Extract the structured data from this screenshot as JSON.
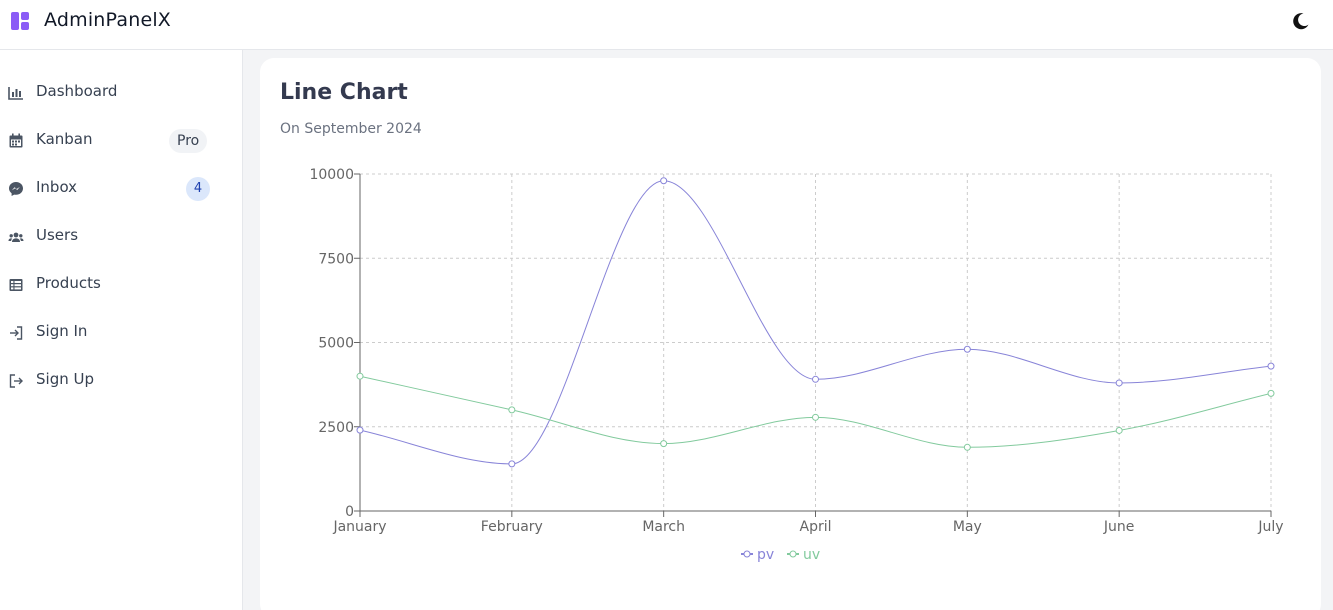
{
  "header": {
    "app_name": "AdminPanelX",
    "logo_icon": "dashboard-layout-icon",
    "theme_toggle_icon": "moon-icon",
    "brand_color": "#8b5cf6"
  },
  "sidebar": {
    "items": [
      {
        "label": "Dashboard",
        "icon": "bar-chart-icon"
      },
      {
        "label": "Kanban",
        "icon": "calendar-icon",
        "badge": "Pro"
      },
      {
        "label": "Inbox",
        "icon": "messenger-icon",
        "badge": "4"
      },
      {
        "label": "Users",
        "icon": "users-icon"
      },
      {
        "label": "Products",
        "icon": "table-list-icon"
      },
      {
        "label": "Sign In",
        "icon": "sign-in-icon"
      },
      {
        "label": "Sign Up",
        "icon": "sign-out-icon"
      }
    ]
  },
  "main": {
    "card_title": "Line Chart",
    "card_subtitle": "On September 2024"
  },
  "chart_data": {
    "type": "line",
    "title": "",
    "xlabel": "",
    "ylabel": "",
    "x": [
      "January",
      "February",
      "March",
      "April",
      "May",
      "June",
      "July"
    ],
    "series": [
      {
        "name": "pv",
        "values": [
          2400,
          1398,
          9800,
          3908,
          4800,
          3800,
          4300
        ],
        "color": "#8884d8"
      },
      {
        "name": "uv",
        "values": [
          4000,
          3000,
          2000,
          2780,
          1890,
          2390,
          3490
        ],
        "color": "#82ca9d"
      }
    ],
    "ylim": [
      0,
      10000
    ],
    "yticks": [
      "0",
      "2500",
      "5000",
      "7500",
      "10000"
    ],
    "grid": true,
    "legend": "bottom-center"
  }
}
